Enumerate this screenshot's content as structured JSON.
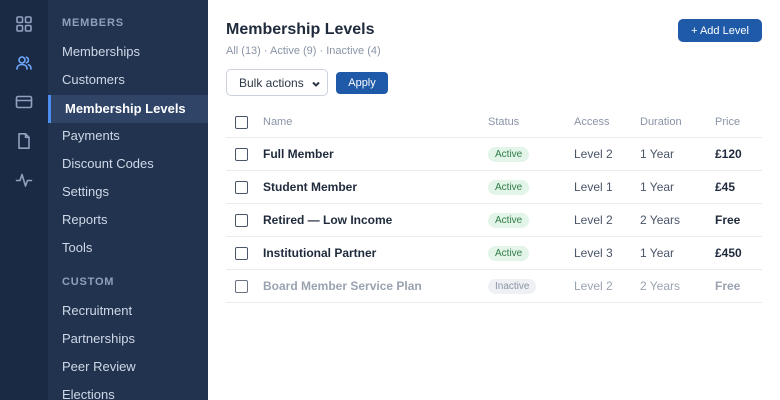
{
  "rail": {
    "icons": [
      "grid-icon",
      "users-icon",
      "card-icon",
      "document-icon",
      "activity-icon"
    ]
  },
  "sidebar": {
    "sections": [
      {
        "heading": "MEMBERS",
        "items": [
          {
            "label": "Memberships",
            "active": false
          },
          {
            "label": "Customers",
            "active": false
          },
          {
            "label": "Membership Levels",
            "active": true
          },
          {
            "label": "Payments",
            "active": false
          },
          {
            "label": "Discount Codes",
            "active": false
          },
          {
            "label": "Settings",
            "active": false
          },
          {
            "label": "Reports",
            "active": false
          },
          {
            "label": "Tools",
            "active": false
          }
        ]
      },
      {
        "heading": "CUSTOM",
        "items": [
          {
            "label": "Recruitment",
            "active": false
          },
          {
            "label": "Partnerships",
            "active": false
          },
          {
            "label": "Peer Review",
            "active": false
          },
          {
            "label": "Elections",
            "active": false
          }
        ]
      }
    ]
  },
  "main": {
    "title": "Membership Levels",
    "filters": "All (13) · Active (9) · Inactive (4)",
    "add_label": "+ Add Level",
    "bulk_label": "Bulk actions",
    "apply_label": "Apply",
    "columns": {
      "name": "Name",
      "status": "Status",
      "access": "Access",
      "duration": "Duration",
      "price": "Price"
    },
    "rows": [
      {
        "name": "Full Member",
        "status": "Active",
        "access": "Level 2",
        "duration": "1 Year",
        "price": "£120"
      },
      {
        "name": "Student Member",
        "status": "Active",
        "access": "Level 1",
        "duration": "1 Year",
        "price": "£45"
      },
      {
        "name": "Retired — Low Income",
        "status": "Active",
        "access": "Level 2",
        "duration": "2 Years",
        "price": "Free"
      },
      {
        "name": "Institutional Partner",
        "status": "Active",
        "access": "Level 3",
        "duration": "1 Year",
        "price": "£450"
      },
      {
        "name": "Board Member Service Plan",
        "status": "Inactive",
        "access": "Level 2",
        "duration": "2 Years",
        "price": "Free"
      }
    ]
  },
  "colors": {
    "rail_bg": "#1b2a44",
    "sidebar_bg": "#22334f",
    "accent": "#1e5aa8",
    "active_badge": "#e3f4e8"
  }
}
